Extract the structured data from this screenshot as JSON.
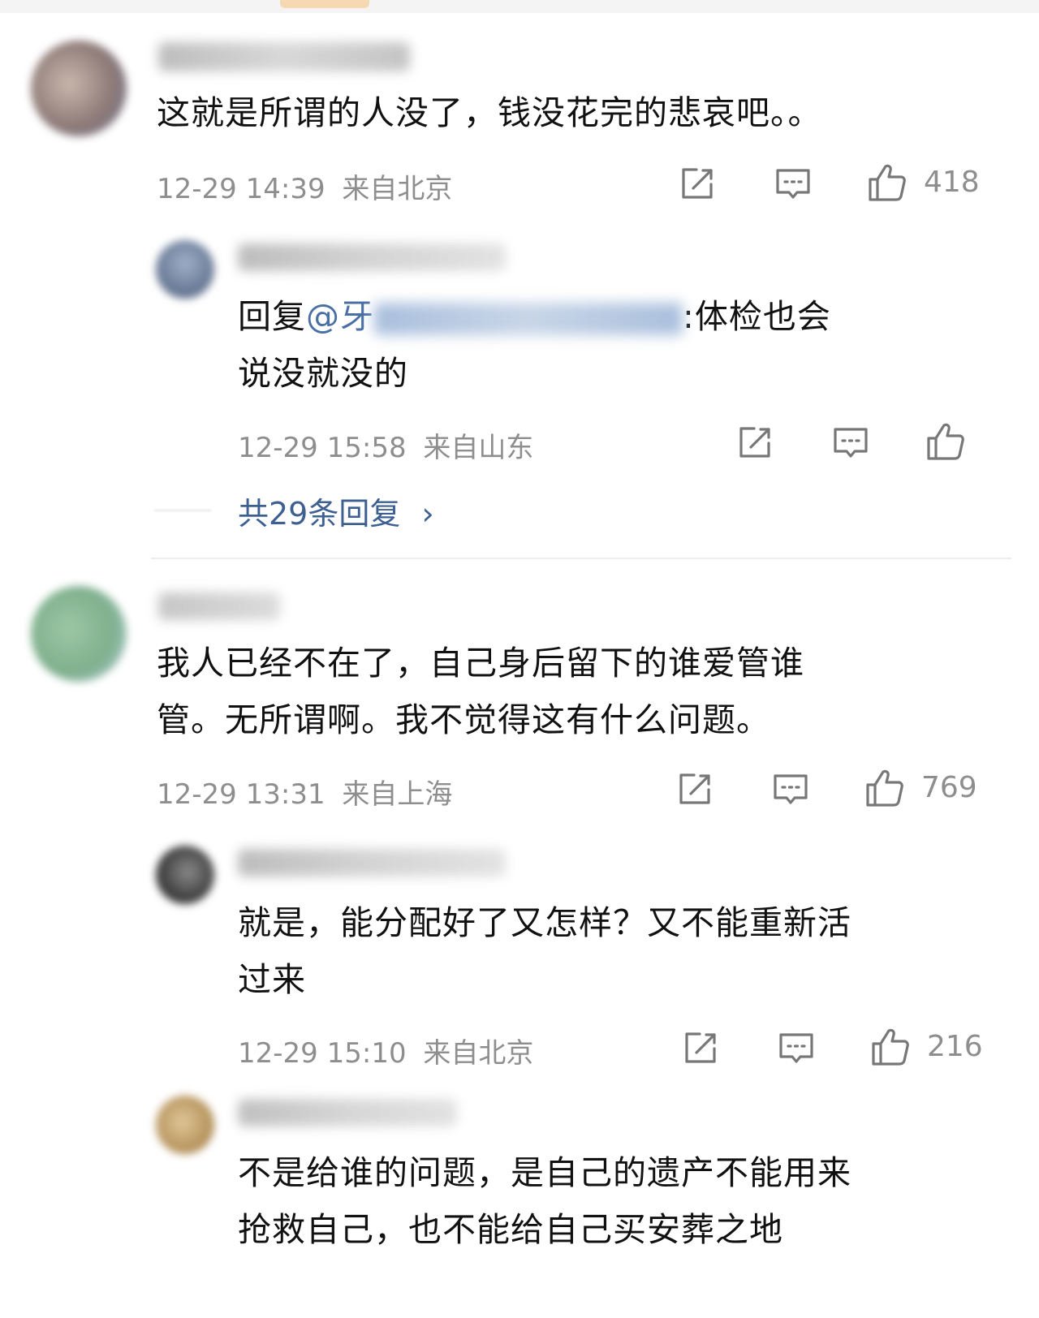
{
  "comments": [
    {
      "user": "",
      "text": "这就是所谓的人没了，钱没花完的悲哀吧。。",
      "time": "12-29 14:39",
      "location": "来自北京",
      "likes": "418",
      "replies": [
        {
          "user": "",
          "reply_prefix": "回复",
          "mention": "@牙",
          "text_after": ":体检也会",
          "text_line2": "说没就没的",
          "time": "12-29 15:58",
          "location": "来自山东",
          "likes": ""
        }
      ],
      "more_replies": "共29条回复",
      "more_chevron": "›"
    },
    {
      "user": "",
      "text_line1": "我人已经不在了，自己身后留下的谁爱管谁",
      "text_line2": "管。无所谓啊。我不觉得这有什么问题。",
      "time": "12-29 13:31",
      "location": "来自上海",
      "likes": "769",
      "replies": [
        {
          "user": "",
          "text_line1": "就是，能分配好了又怎样？又不能重新活",
          "text_line2": "过来",
          "time": "12-29 15:10",
          "location": "来自北京",
          "likes": "216"
        },
        {
          "user": "",
          "text_line1": "不是给谁的问题，是自己的遗产不能用来",
          "text_line2": "抢救自己，也不能给自己买安葬之地"
        }
      ]
    }
  ],
  "icons": {
    "share": "share-icon",
    "comment": "comment-icon",
    "like": "thumbs-up-icon"
  },
  "colors": {
    "link": "#3d5f91",
    "meta": "#8e8e8e",
    "text": "#111111"
  }
}
